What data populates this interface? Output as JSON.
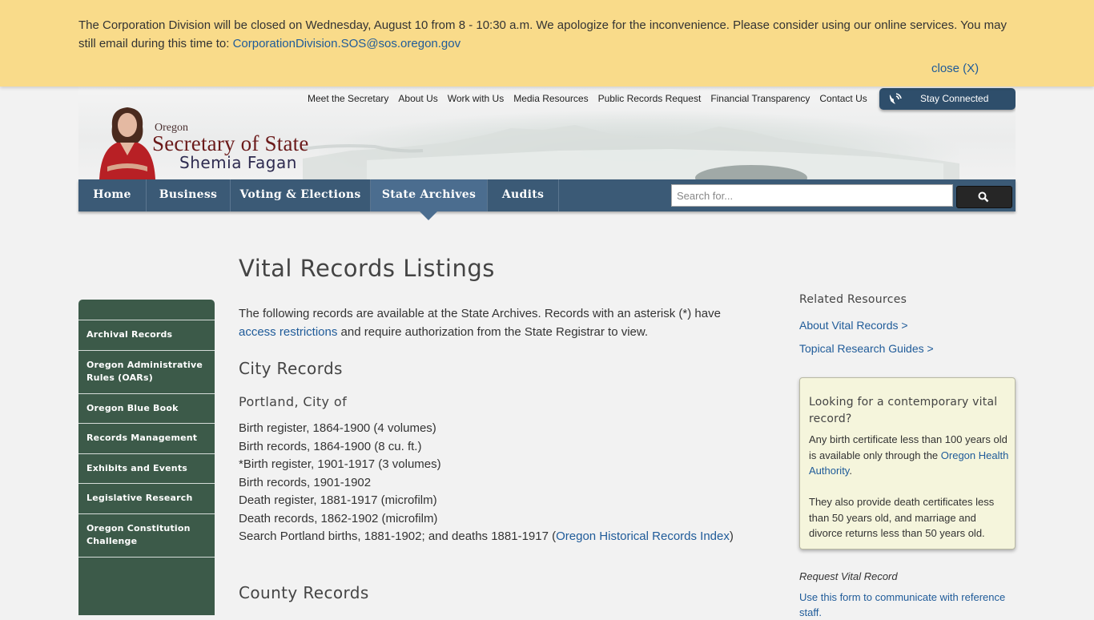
{
  "alert": {
    "text_pre": "The Corporation Division will be closed on Wednesday, August 10 from 8 - 10:30 a.m. We apologize for the inconvenience.  Please consider using our online services.  You may still email during this time to: ",
    "email": "CorporationDivision.SOS@sos.oregon.gov",
    "close": "close (X)"
  },
  "header": {
    "logo_oregon": "Oregon",
    "logo_title": "Secretary of State",
    "logo_name": "Shemia Fagan",
    "top_links": [
      "Meet the Secretary",
      "About Us",
      "Work with Us",
      "Media Resources",
      "Public Records Request",
      "Financial Transparency",
      "Contact Us"
    ],
    "stay_connected": "Stay Connected"
  },
  "nav": {
    "items": [
      "Home",
      "Business",
      "Voting & Elections",
      "State Archives",
      "Audits"
    ],
    "active": "State Archives",
    "search_placeholder": "Search for..."
  },
  "sidebar": {
    "items": [
      "Archival Records",
      "Oregon Administrative Rules (OARs)",
      "Oregon Blue Book",
      "Records Management",
      "Exhibits and Events",
      "Legislative Research",
      "Oregon Constitution Challenge"
    ]
  },
  "content": {
    "title": "Vital Records Listings",
    "intro_pre": " The following records are available at the State Archives. Records with an asterisk (*) have ",
    "intro_link": "access restrictions",
    "intro_post": " and require authorization from the State Registrar to view.",
    "city_heading": "City Records",
    "portland_heading": "Portland, City of",
    "records": [
      "Birth register, 1864-1900 (4 volumes)",
      "Birth records, 1864-1900 (8 cu. ft.)",
      "*Birth register, 1901-1917 (3 volumes)",
      "Birth records, 1901-1902",
      "Death register, 1881-1917 (microfilm)",
      "Death records, 1862-1902 (microfilm)"
    ],
    "search_pre": "Search Portland births, 1881-1902; and deaths 1881-1917 (",
    "search_link": "Oregon Historical Records Index",
    "search_post": ")",
    "county_heading": "County Records"
  },
  "right": {
    "related_title": "Related Resources",
    "links": [
      "About Vital Records >",
      "Topical Research Guides >"
    ],
    "callout_title": "Looking for a contemporary vital record?",
    "callout_p1_pre": "Any birth certificate less than 100 years old is available only through the ",
    "callout_p1_link": "Oregon Health Authority",
    "callout_p1_post": ".",
    "callout_p2": "They also provide death certificates less than 50 years old, and marriage and divorce returns less than 50 years old.",
    "request_title": "Request Vital Record",
    "request_link": "Use this form to communicate with reference staff."
  },
  "colors": {
    "banner": "#f9db8a",
    "nav": "#3b5a76",
    "nav_active": "#4b6d8f",
    "sidebar": "#3c5a49",
    "link": "#1f5b99",
    "callout": "#f5f5dc"
  }
}
